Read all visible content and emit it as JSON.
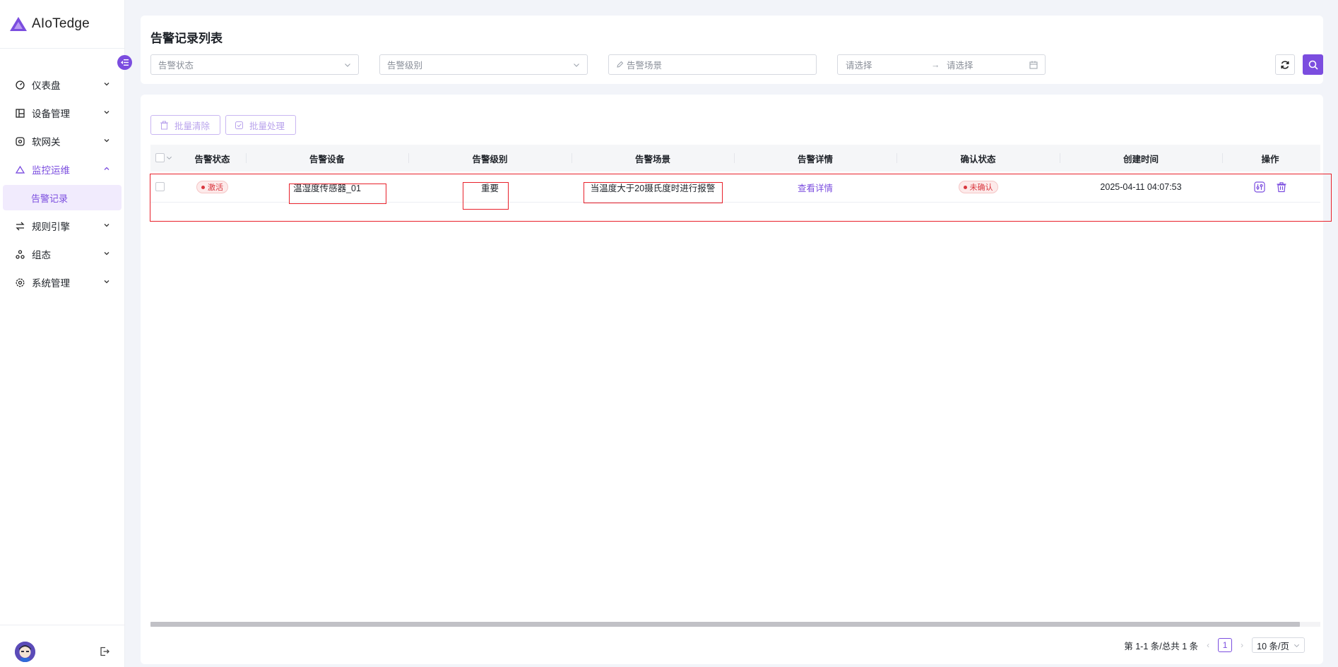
{
  "app": {
    "name": "AIoTedge"
  },
  "sidebar": {
    "items": [
      {
        "label": "仪表盘",
        "icon": "dashboard-icon"
      },
      {
        "label": "设备管理",
        "icon": "device-icon"
      },
      {
        "label": "软网关",
        "icon": "gateway-icon"
      },
      {
        "label": "监控运维",
        "icon": "monitor-icon",
        "open": true,
        "children": [
          {
            "label": "告警记录",
            "active": true
          }
        ]
      },
      {
        "label": "规则引擎",
        "icon": "rules-icon"
      },
      {
        "label": "组态",
        "icon": "config-icon"
      },
      {
        "label": "系统管理",
        "icon": "settings-icon"
      }
    ]
  },
  "filters": {
    "title": "告警记录列表",
    "status_placeholder": "告警状态",
    "level_placeholder": "告警级别",
    "scene_placeholder": "告警场景",
    "date_start_placeholder": "请选择",
    "date_end_placeholder": "请选择"
  },
  "toolbar": {
    "batch_clear": "批量清除",
    "batch_process": "批量处理"
  },
  "table": {
    "columns": [
      "告警状态",
      "告警设备",
      "告警级别",
      "告警场景",
      "告警详情",
      "确认状态",
      "创建时间",
      "操作"
    ],
    "rows": [
      {
        "status": "激活",
        "device": "温湿度传感器_01",
        "level": "重要",
        "scene": "当温度大于20摄氏度时进行报警",
        "detail": "查看详情",
        "confirm": "未确认",
        "created": "2025-04-11 04:07:53"
      }
    ]
  },
  "pagination": {
    "summary": "第 1-1 条/总共 1 条",
    "current": "1",
    "page_size": "10 条/页"
  },
  "colors": {
    "accent": "#7b4ddf",
    "danger": "#d9363e",
    "highlight": "#e8202a"
  }
}
